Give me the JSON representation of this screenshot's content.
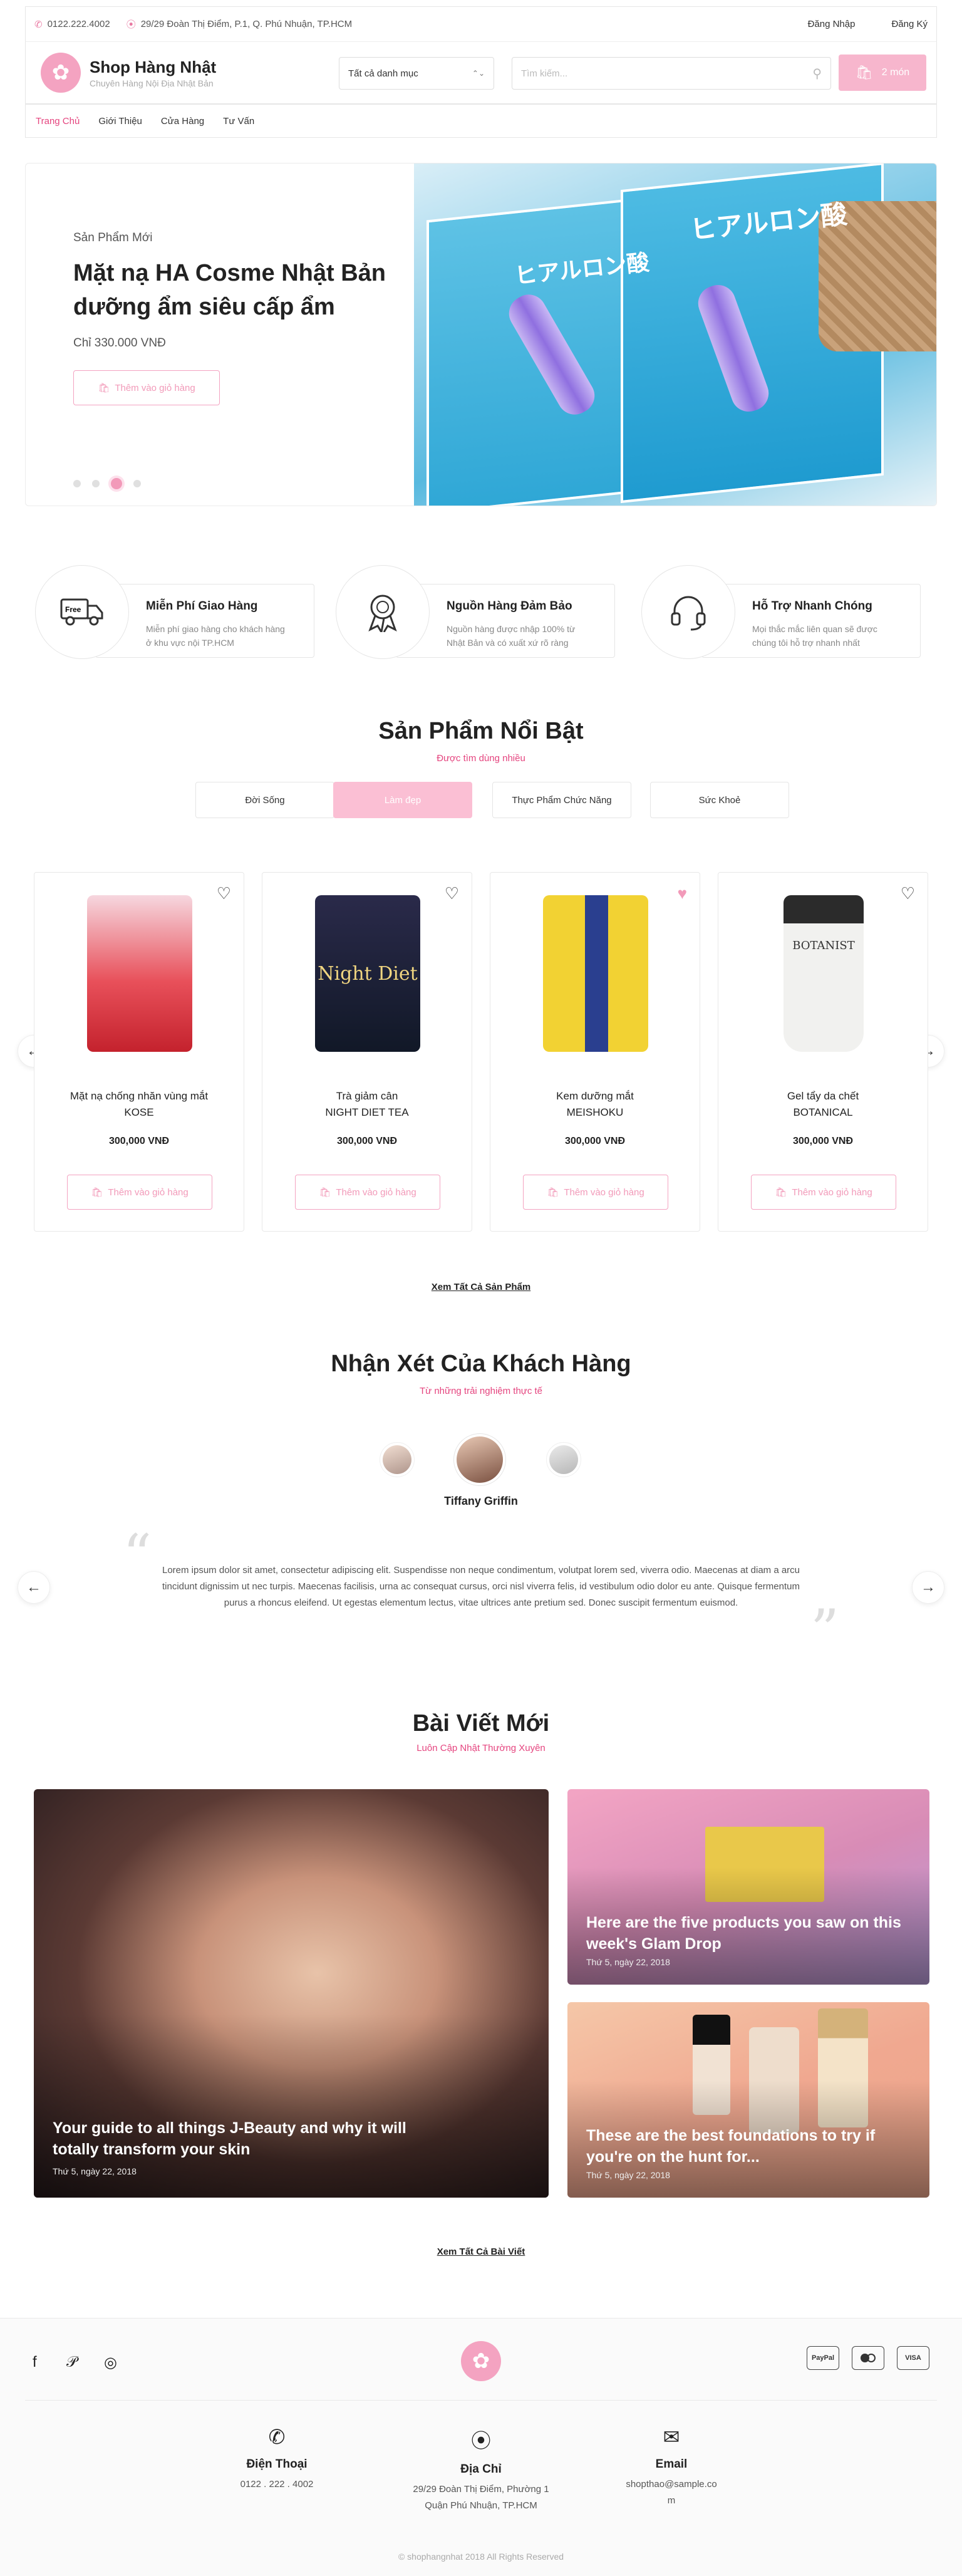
{
  "topbar": {
    "phone": "0122.222.4002",
    "address": "29/29 Đoàn Thị Điểm, P.1, Q. Phú Nhuận, TP.HCM",
    "login": "Đăng Nhập",
    "register": "Đăng Ký"
  },
  "header": {
    "shop_name": "Shop Hàng Nhật",
    "tagline": "Chuyên Hàng Nội Địa Nhật Bản",
    "category_select": "Tất cả danh mục",
    "search_placeholder": "Tìm kiếm...",
    "cart_label": "2 món"
  },
  "nav": [
    "Trang Chủ",
    "Giới Thiệu",
    "Cửa Hàng",
    "Tư Vấn"
  ],
  "hero": {
    "subtitle": "Sản Phẩm Mới",
    "title": "Mặt nạ HA Cosme Nhật Bản dưỡng ẩm siêu cấp ẩm",
    "price": "Chỉ 330.000 VNĐ",
    "button": "Thêm vào giỏ hàng",
    "image_text_1": "ヒアルロン酸",
    "image_text_2": "ヒアルロン酸",
    "active_slide": 3,
    "slide_count": 4
  },
  "features": [
    {
      "title": "Miễn Phí Giao Hàng",
      "desc": "Miễn phí giao hàng cho khách hàng ở khu vực nội TP.HCM",
      "icon": "truck-icon",
      "icon_label": "Free"
    },
    {
      "title": "Nguồn Hàng Đảm Bảo",
      "desc": "Nguồn hàng được nhập 100% từ Nhật Bản và có xuất xứ rõ ràng",
      "icon": "award-icon"
    },
    {
      "title": "Hỗ Trợ Nhanh Chóng",
      "desc": "Mọi thắc mắc liên quan sẽ được chúng tôi hỗ trợ nhanh nhất",
      "icon": "headset-icon"
    }
  ],
  "featured": {
    "title": "Sản Phẩm Nổi Bật",
    "subtitle": "Được tìm dùng nhiều",
    "tabs": [
      "Đời Sống",
      "Làm đẹp",
      "Thực Phẩm Chức Năng",
      "Sức Khoẻ"
    ],
    "active_tab": 1,
    "products": [
      {
        "name1": "Mặt nạ chống nhăn vùng mắt",
        "name2": "KOSE",
        "price": "300,000 VNĐ",
        "button": "Thêm vào giỏ hàng",
        "favorite": false,
        "color": "#d9343f"
      },
      {
        "name1": "Trà giảm cân",
        "name2": "NIGHT DIET TEA",
        "price": "300,000 VNĐ",
        "button": "Thêm vào giỏ hàng",
        "favorite": false,
        "color": "#1a1a2e",
        "image_text": "Night Diet"
      },
      {
        "name1": "Kem dưỡng mắt",
        "name2": "MEISHOKU",
        "price": "300,000 VNĐ",
        "button": "Thêm vào giỏ hàng",
        "favorite": true,
        "color": "#e9c21f"
      },
      {
        "name1": "Gel tẩy da chết",
        "name2": "BOTANICAL",
        "price": "300,000 VNĐ",
        "button": "Thêm vào giỏ hàng",
        "favorite": false,
        "color": "#2b2b2b",
        "image_text": "BOTANIST"
      }
    ],
    "view_all": "Xem Tất Cả Sản Phẩm"
  },
  "reviews": {
    "title": "Nhận Xét Của Khách Hàng",
    "subtitle": "Từ những trải nghiệm thực tế",
    "reviewer": "Tiffany Griffin",
    "text": "Lorem ipsum dolor sit amet, consectetur adipiscing elit. Suspendisse non neque condimentum, volutpat lorem sed, viverra odio. Maecenas at diam a arcu tincidunt dignissim ut nec turpis. Maecenas facilisis, urna ac consequat cursus, orci nisl viverra felis, id vestibulum odio dolor eu ante. Quisque fermentum purus a rhoncus eleifend. Ut egestas elementum lectus, vitae ultrices ante pretium sed. Donec suscipit fermentum euismod."
  },
  "blog": {
    "title": "Bài Viết Mới",
    "subtitle": "Luôn Cập Nhật Thường Xuyên",
    "posts": [
      {
        "title": "Your guide to all things J-Beauty and why it will totally transform your skin",
        "date": "Thứ 5, ngày 22, 2018"
      },
      {
        "title": "Here are the five products you saw on this week's Glam Drop",
        "date": "Thứ 5, ngày 22, 2018"
      },
      {
        "title": "These are the best foundations to try if you're on the hunt for...",
        "date": "Thứ 5, ngày 22, 2018"
      }
    ],
    "view_all": "Xem Tất Cả Bài Viết"
  },
  "footer": {
    "payments": [
      "PayPal",
      "VISA"
    ],
    "phone_label": "Điện Thoại",
    "phone": "0122 . 222 . 4002",
    "address_label": "Địa Chỉ",
    "address1": "29/29 Đoàn Thị Điểm, Phường 1",
    "address2": "Quận Phú Nhuận, TP.HCM",
    "email_label": "Email",
    "email1": "shopthao@sample.co",
    "email2": "m",
    "copyright": "© shophangnhat 2018 All Rights Reserved"
  }
}
